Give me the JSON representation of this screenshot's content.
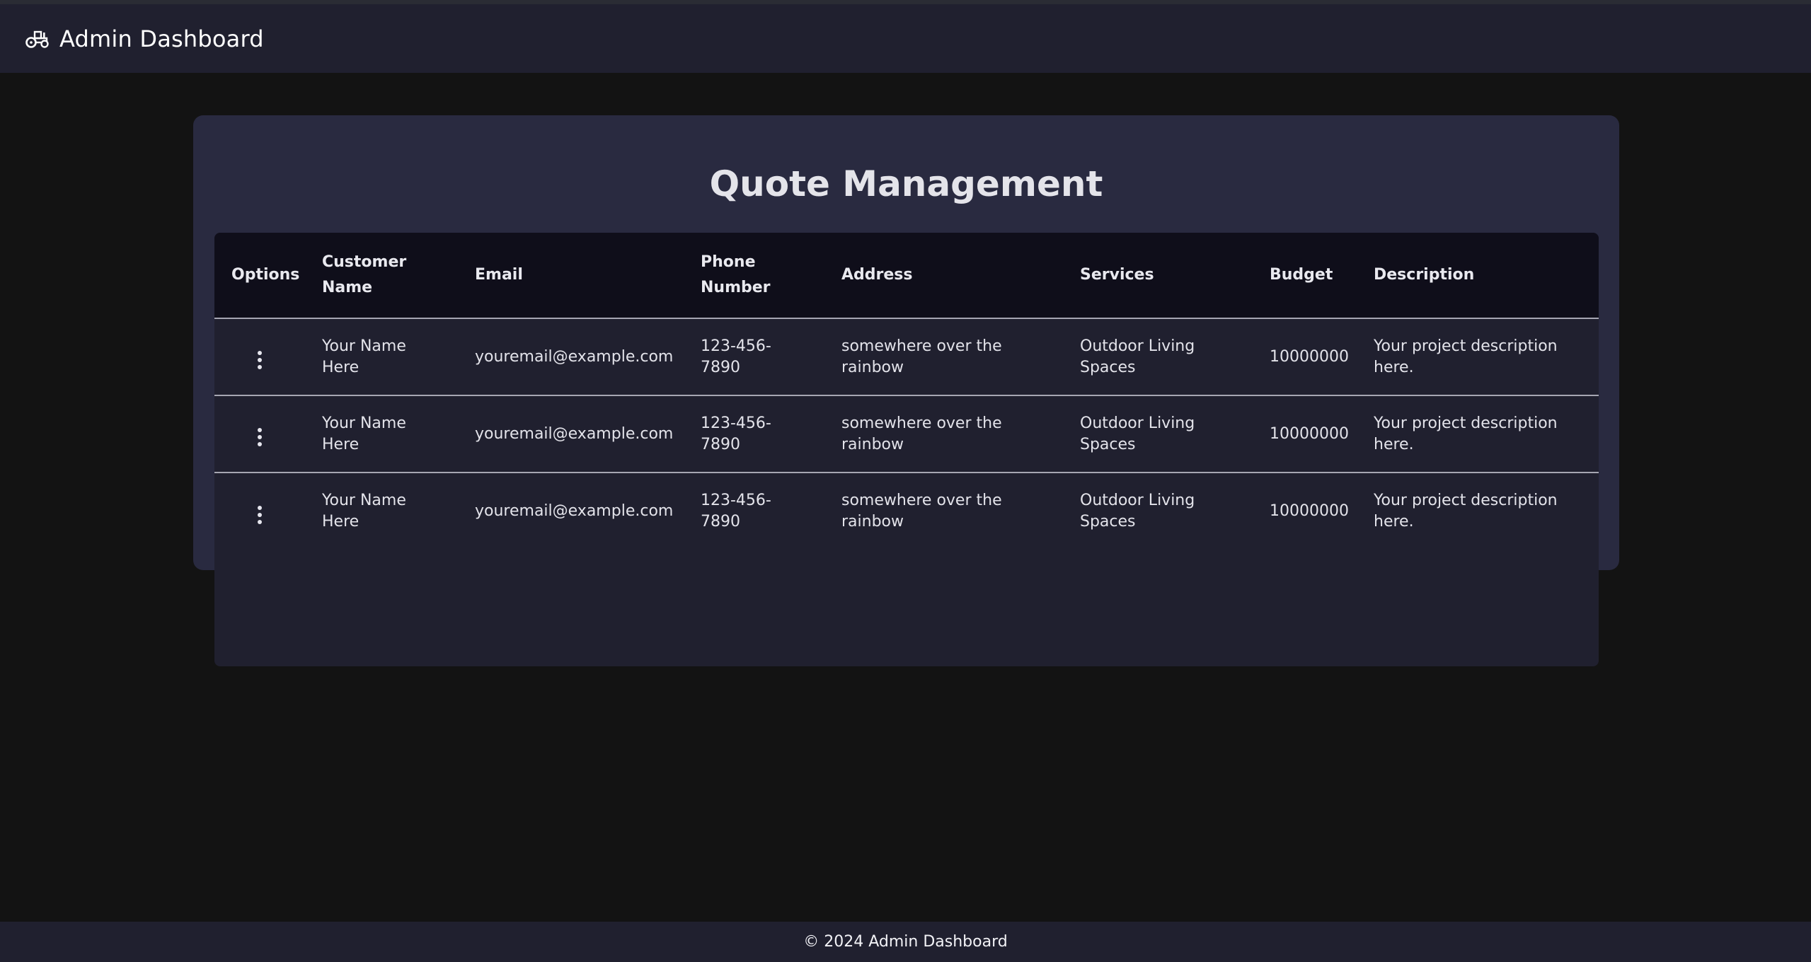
{
  "navbar": {
    "brand_icon": "tractor-icon",
    "title": "Admin Dashboard"
  },
  "main": {
    "title": "Quote Management",
    "table": {
      "headers": [
        "Options",
        "Customer Name",
        "Email",
        "Phone Number",
        "Address",
        "Services",
        "Budget",
        "Description"
      ],
      "options_icon": "kebab-menu-icon",
      "rows": [
        {
          "customer_name": "Your Name Here",
          "email": "youremail@example.com",
          "phone": "123-456-7890",
          "address": "somewhere over the rainbow",
          "services": "Outdoor Living Spaces",
          "budget": "10000000",
          "description": "Your project description here."
        },
        {
          "customer_name": "Your Name Here",
          "email": "youremail@example.com",
          "phone": "123-456-7890",
          "address": "somewhere over the rainbow",
          "services": "Outdoor Living Spaces",
          "budget": "10000000",
          "description": "Your project description here."
        },
        {
          "customer_name": "Your Name Here",
          "email": "youremail@example.com",
          "phone": "123-456-7890",
          "address": "somewhere over the rainbow",
          "services": "Outdoor Living Spaces",
          "budget": "10000000",
          "description": "Your project description here."
        }
      ]
    }
  },
  "footer": {
    "text": "© 2024 Admin Dashboard"
  },
  "colors": {
    "page_bg": "#131313",
    "navbar_bg": "#20202f",
    "card_bg": "#292a40",
    "table_header_bg": "#0f0e1a",
    "table_body_bg": "#20202f"
  }
}
